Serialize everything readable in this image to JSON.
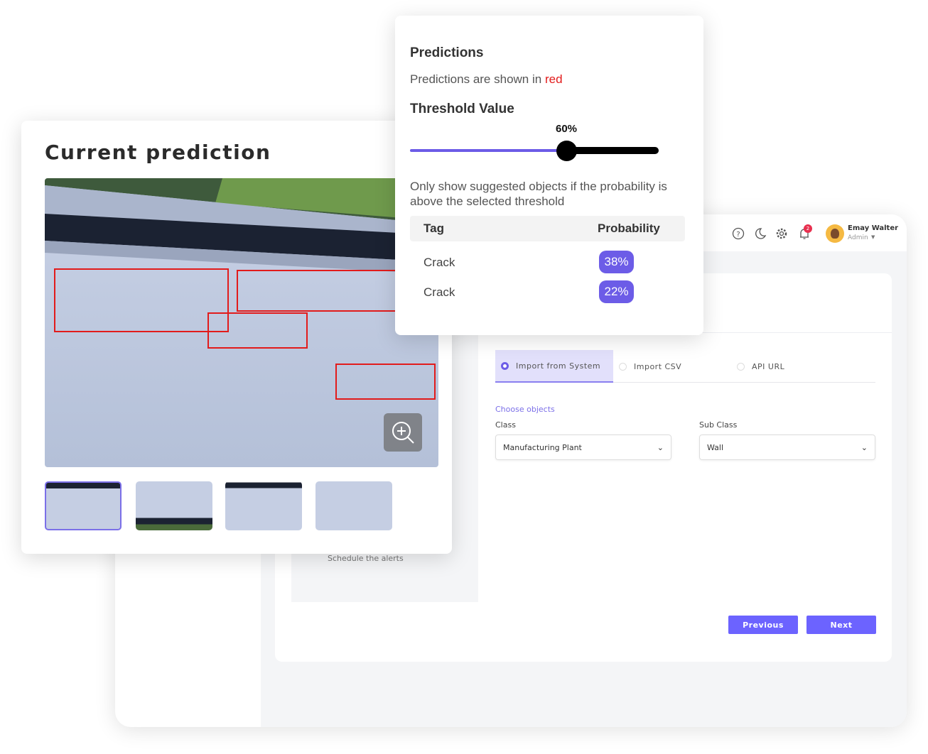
{
  "header": {
    "user_name": "Emay Walter",
    "user_role": "Admin",
    "notification_count": "2",
    "icons": [
      "help-icon",
      "moon-icon",
      "gear-icon",
      "bell-icon"
    ]
  },
  "sidebar": {
    "schedule_label": "Schedule the alerts"
  },
  "import": {
    "tabs": [
      {
        "label": "Import from System",
        "selected": true
      },
      {
        "label": "Import CSV",
        "selected": false
      },
      {
        "label": "API URL",
        "selected": false
      }
    ],
    "section_title": "Choose objects",
    "class_label": "Class",
    "class_value": "Manufacturing Plant",
    "subclass_label": "Sub Class",
    "subclass_value": "Wall",
    "previous_label": "Previous",
    "next_label": "Next"
  },
  "prediction": {
    "title": "Current prediction",
    "thumbnail_count": 4,
    "selected_thumbnail": 0
  },
  "popup": {
    "title": "Predictions",
    "subtitle_prefix": "Predictions are shown in",
    "subtitle_highlight": "red",
    "threshold_title": "Threshold Value",
    "threshold_value": 60,
    "threshold_label": "60%",
    "description": "Only show suggested objects if the probability is above the selected threshold",
    "table": {
      "headers": [
        "Tag",
        "Probability"
      ],
      "rows": [
        {
          "tag": "Crack",
          "probability": "38%"
        },
        {
          "tag": "Crack",
          "probability": "22%"
        }
      ]
    }
  },
  "colors": {
    "accent": "#6c5ce7",
    "prediction": "#e21b1b",
    "badge": "#e8304f"
  }
}
